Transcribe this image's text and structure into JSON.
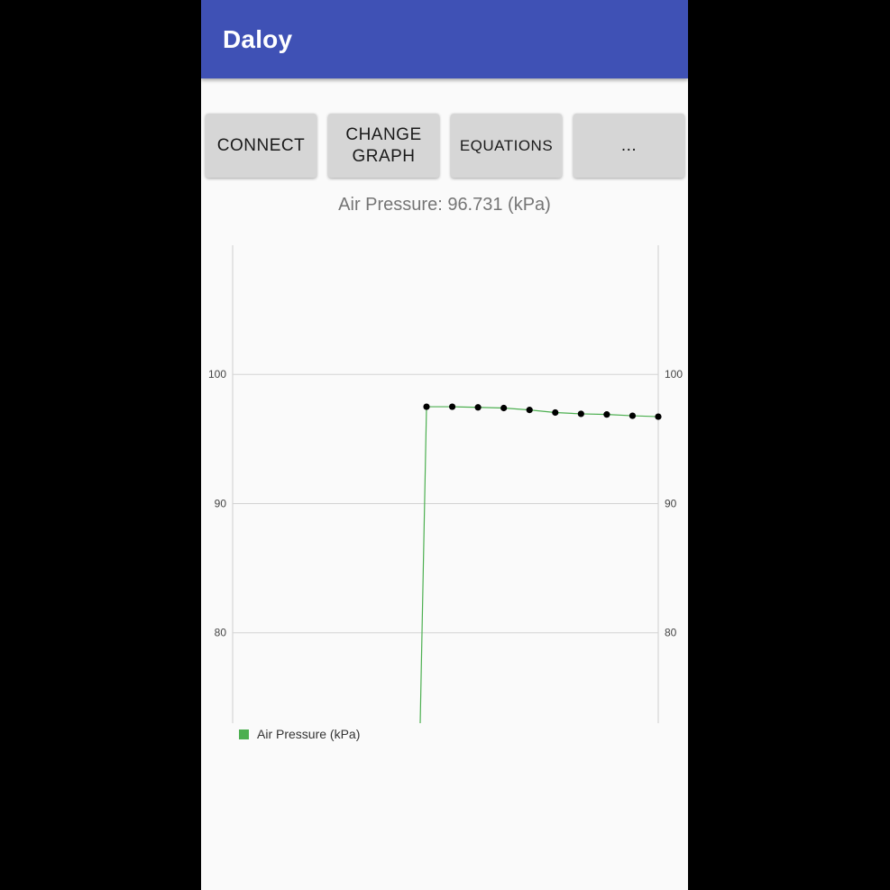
{
  "app": {
    "title": "Daloy"
  },
  "buttons": [
    {
      "label": "CONNECT"
    },
    {
      "label": "CHANGE\nGRAPH"
    },
    {
      "label": "EQUATIONS"
    },
    {
      "label": "..."
    }
  ],
  "readout": "Air Pressure: 96.731 (kPa)",
  "colors": {
    "app_bar": "#3f51b5",
    "series": "#4caf50",
    "points": "#000000"
  },
  "chart_data": {
    "type": "line",
    "ylim": [
      73,
      110
    ],
    "y_ticks": [
      {
        "value": 100,
        "label": "100"
      },
      {
        "value": 90,
        "label": "90"
      },
      {
        "value": 80,
        "label": "80"
      }
    ],
    "y_axis_right": true,
    "grid": true,
    "legend_position": "bottom-left",
    "series": [
      {
        "name": "Air Pressure (kPa)",
        "color": "#4caf50",
        "start_value": 73,
        "x": [
          1,
          2,
          3,
          4,
          5,
          6,
          7,
          8,
          9,
          10
        ],
        "values": [
          97.5,
          97.5,
          97.45,
          97.4,
          97.25,
          97.05,
          96.95,
          96.9,
          96.8,
          96.73
        ]
      }
    ]
  }
}
